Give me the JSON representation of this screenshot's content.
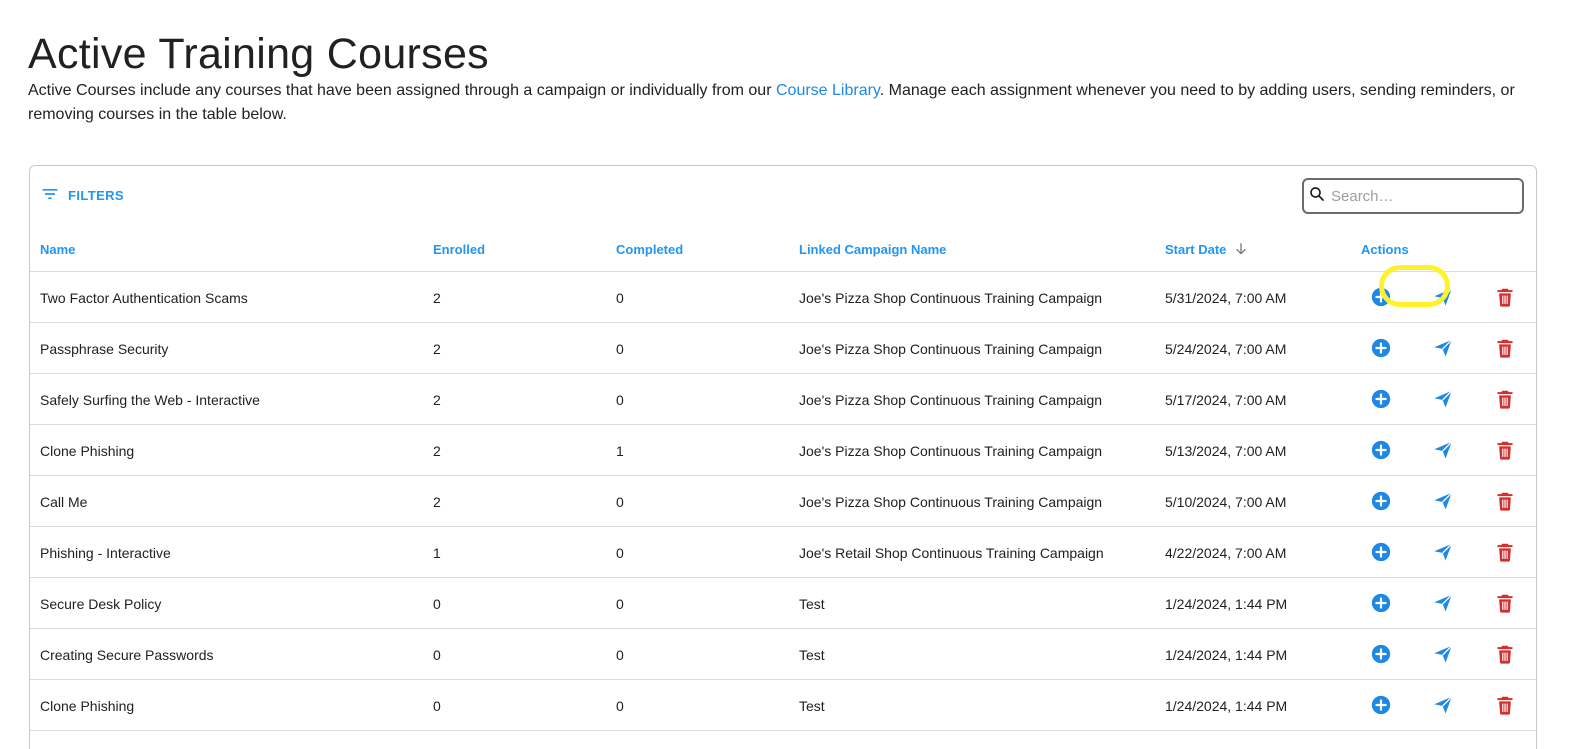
{
  "header": {
    "title": "Active Training Courses",
    "description_before": "Active Courses include any courses that have been assigned through a campaign or individually from our ",
    "description_link": "Course Library",
    "description_after": ". Manage each assignment whenever you need to by adding users, sending reminders, or removing courses in the table below."
  },
  "toolbar": {
    "filters_label": "FILTERS",
    "search_placeholder": "Search…",
    "search_value": ""
  },
  "table": {
    "columns": {
      "name": "Name",
      "enrolled": "Enrolled",
      "completed": "Completed",
      "campaign": "Linked Campaign Name",
      "start_date": "Start Date",
      "actions": "Actions"
    },
    "sort": {
      "column": "start_date",
      "direction": "descending"
    },
    "rows": [
      {
        "name": "Two Factor Authentication Scams",
        "enrolled": "2",
        "completed": "0",
        "campaign": "Joe's Pizza Shop Continuous Training Campaign",
        "start_date": "5/31/2024, 7:00 AM"
      },
      {
        "name": "Passphrase Security",
        "enrolled": "2",
        "completed": "0",
        "campaign": "Joe's Pizza Shop Continuous Training Campaign",
        "start_date": "5/24/2024, 7:00 AM"
      },
      {
        "name": "Safely Surfing the Web - Interactive",
        "enrolled": "2",
        "completed": "0",
        "campaign": "Joe's Pizza Shop Continuous Training Campaign",
        "start_date": "5/17/2024, 7:00 AM"
      },
      {
        "name": "Clone Phishing",
        "enrolled": "2",
        "completed": "1",
        "campaign": "Joe's Pizza Shop Continuous Training Campaign",
        "start_date": "5/13/2024, 7:00 AM"
      },
      {
        "name": "Call Me",
        "enrolled": "2",
        "completed": "0",
        "campaign": "Joe's Pizza Shop Continuous Training Campaign",
        "start_date": "5/10/2024, 7:00 AM"
      },
      {
        "name": "Phishing - Interactive",
        "enrolled": "1",
        "completed": "0",
        "campaign": "Joe's Retail Shop Continuous Training Campaign",
        "start_date": "4/22/2024, 7:00 AM"
      },
      {
        "name": "Secure Desk Policy",
        "enrolled": "0",
        "completed": "0",
        "campaign": "Test",
        "start_date": "1/24/2024, 1:44 PM"
      },
      {
        "name": "Creating Secure Passwords",
        "enrolled": "0",
        "completed": "0",
        "campaign": "Test",
        "start_date": "1/24/2024, 1:44 PM"
      },
      {
        "name": "Clone Phishing",
        "enrolled": "0",
        "completed": "0",
        "campaign": "Test",
        "start_date": "1/24/2024, 1:44 PM"
      }
    ],
    "row_actions": [
      "add-user-icon",
      "send-reminder-icon",
      "delete-icon"
    ],
    "highlighted_action": {
      "row": 3,
      "action": "send-reminder-icon"
    }
  },
  "colors": {
    "accent": "#2196f3",
    "link": "#1e88e5",
    "delete": "#d32f2f",
    "highlight": "#fff12b",
    "border": "#dcdcdc"
  }
}
